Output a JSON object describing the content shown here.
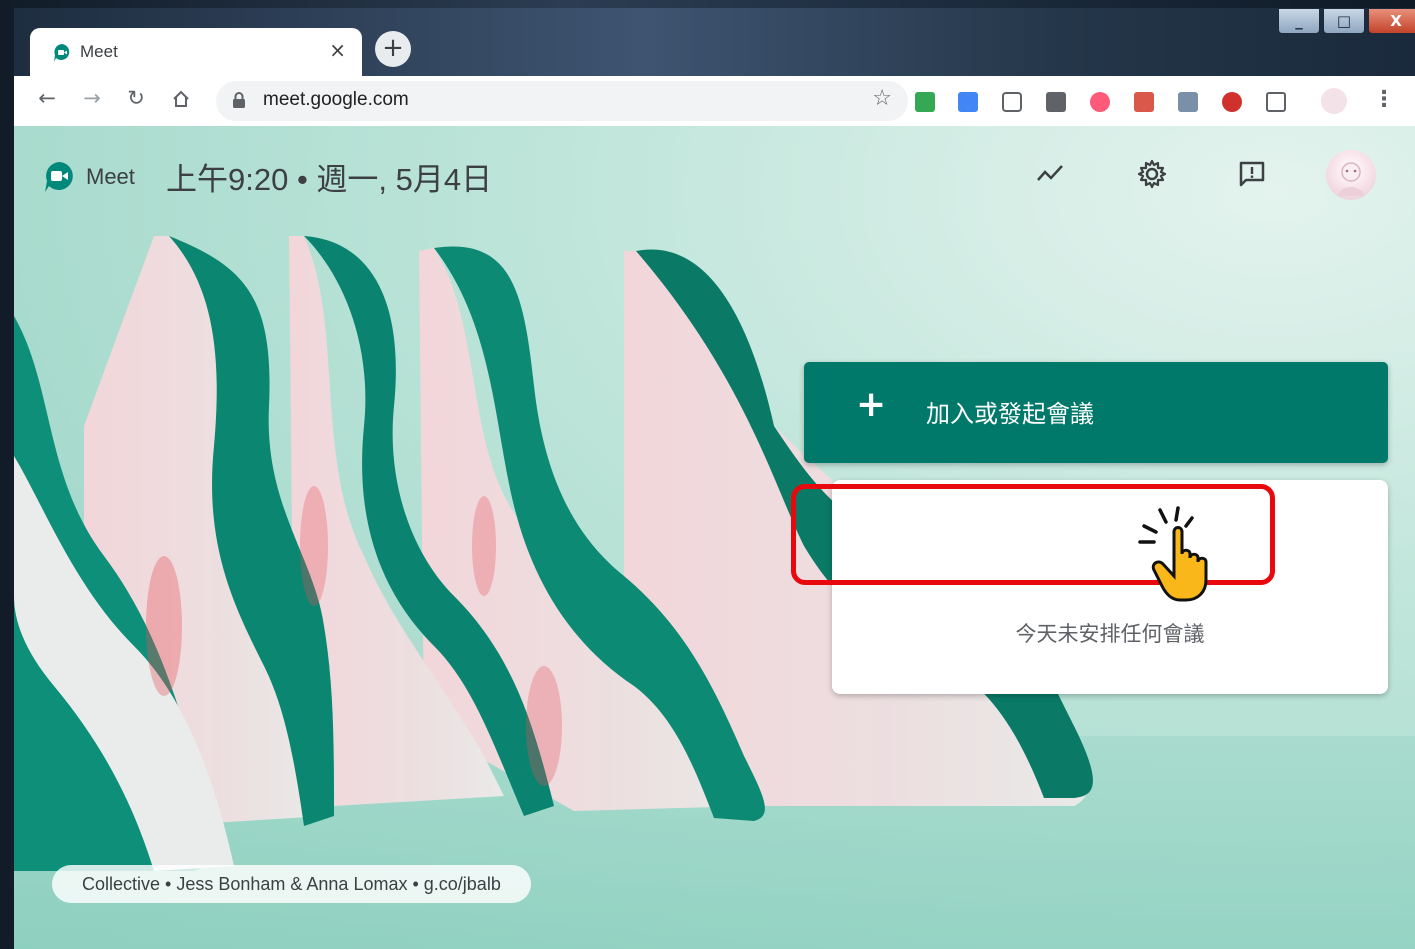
{
  "browser": {
    "tab_title": "Meet",
    "tab_close": "×",
    "new_tab": "+",
    "url": "meet.google.com",
    "window_controls": {
      "minimize": "_",
      "maximize": "□",
      "close": "X"
    }
  },
  "meet": {
    "app_name": "Meet",
    "time_date": "上午9:20 • 週一, 5月4日",
    "join_button_icon": "+",
    "join_button_label": "加入或發起會議",
    "no_meetings_text": "今天未安排任何會議",
    "background_credit": "Collective • Jess Bonham & Anna Lomax • g.co/jbalb"
  },
  "icons": {
    "meet_logo": "meet-logo-icon",
    "activity": "trending-icon",
    "settings": "gear-icon",
    "feedback": "feedback-icon"
  },
  "colors": {
    "meet_green": "#00796b",
    "highlight_red": "#e8090f"
  }
}
